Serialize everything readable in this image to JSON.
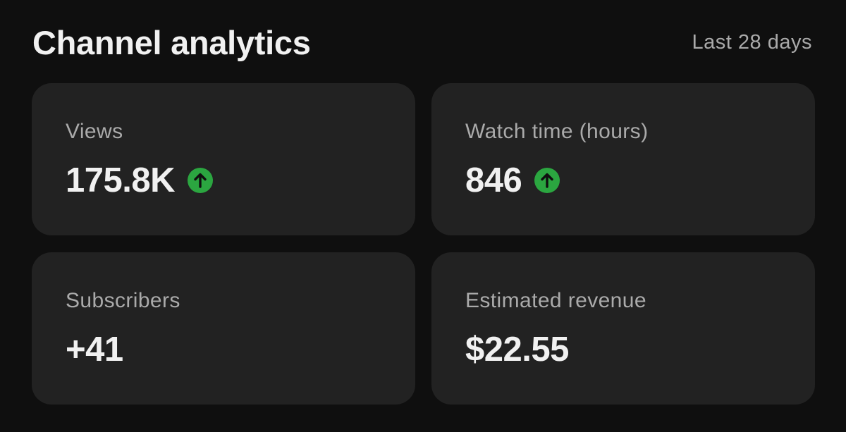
{
  "header": {
    "title": "Channel analytics",
    "period": "Last 28 days"
  },
  "cards": [
    {
      "label": "Views",
      "value": "175.8K",
      "trend": "up",
      "trend_icon": "arrow-up-circle-icon"
    },
    {
      "label": "Watch time (hours)",
      "value": "846",
      "trend": "up",
      "trend_icon": "arrow-up-circle-icon"
    },
    {
      "label": "Subscribers",
      "value": "+41"
    },
    {
      "label": "Estimated revenue",
      "value": "$22.55"
    }
  ],
  "colors": {
    "background": "#0f0f0f",
    "card": "#222222",
    "text_primary": "#f1f1f1",
    "text_secondary": "#aaaaaa",
    "trend_up": "#2ba640"
  }
}
